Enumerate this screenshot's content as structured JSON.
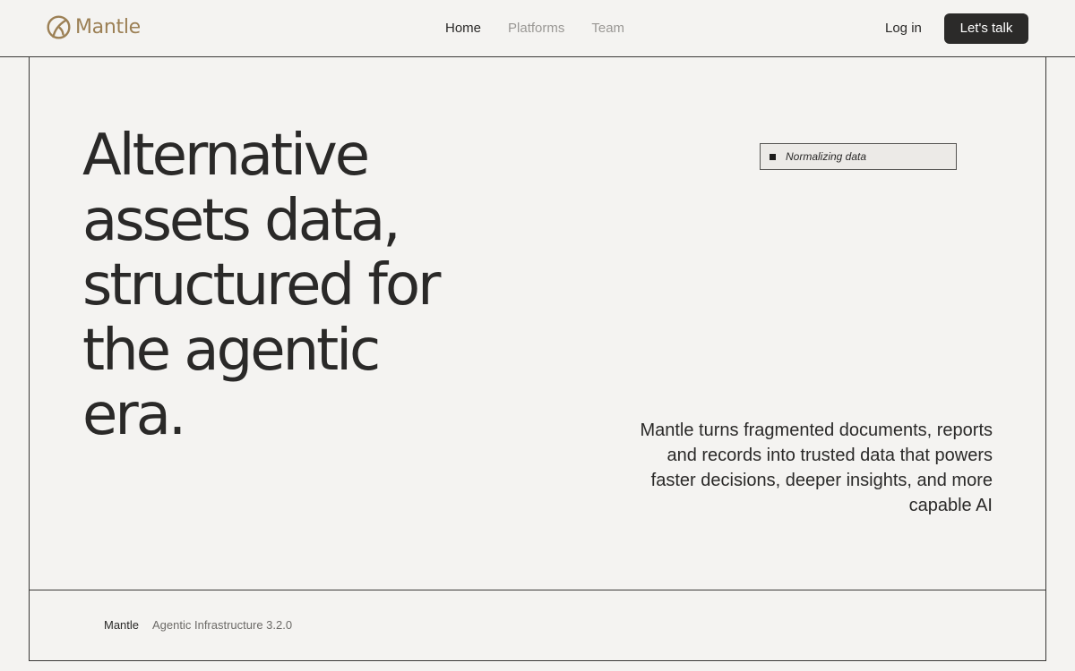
{
  "brand": {
    "name": "Mantle",
    "logo_color": "#9c8055",
    "icon": "mantle-logo-icon"
  },
  "nav": {
    "items": [
      {
        "label": "Home",
        "active": true
      },
      {
        "label": "Platforms",
        "active": false
      },
      {
        "label": "Team",
        "active": false
      }
    ]
  },
  "header": {
    "login_label": "Log in",
    "cta_label": "Let's talk"
  },
  "hero": {
    "title_lines": [
      "Alternative",
      "assets data,",
      "structured for",
      "the agentic",
      "era."
    ],
    "status_text": "Normalizing data",
    "description": "Mantle turns fragmented documents, reports and records into trusted data that powers faster decisions, deeper insights, and more capable AI"
  },
  "footer": {
    "brand": "Mantle",
    "version": "Agentic Infrastructure 3.2.0"
  },
  "colors": {
    "background": "#f4f3f1",
    "text": "#2a2928",
    "muted": "#9a9895",
    "cta_background": "#2b2a29"
  }
}
